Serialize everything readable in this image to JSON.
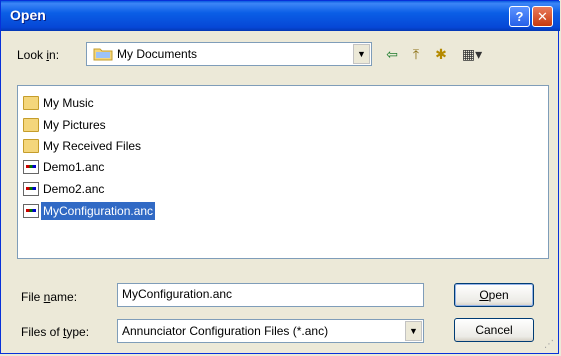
{
  "window": {
    "title": "Open",
    "help_glyph": "?",
    "close_glyph": "✕"
  },
  "lookin": {
    "label_pre": "Look ",
    "label_accel": "i",
    "label_post": "n:",
    "value": "My Documents",
    "icon": "folder-icon"
  },
  "toolbar": {
    "back_icon": "⇦",
    "up_icon": "⤒",
    "new_folder_icon": "✱",
    "views_icon": "▦▾"
  },
  "files": [
    {
      "name": "My Music",
      "kind": "folder"
    },
    {
      "name": "My Pictures",
      "kind": "folder"
    },
    {
      "name": "My Received Files",
      "kind": "folder"
    },
    {
      "name": "Demo1.anc",
      "kind": "file"
    },
    {
      "name": "Demo2.anc",
      "kind": "file"
    },
    {
      "name": "MyConfiguration.anc",
      "kind": "file",
      "selected": true
    }
  ],
  "filename": {
    "label_pre": "File ",
    "label_accel": "n",
    "label_post": "ame:",
    "value": "MyConfiguration.anc"
  },
  "filetype": {
    "label_pre": "Files of ",
    "label_accel": "t",
    "label_post": "ype:",
    "value": "Annunciator Configuration Files (*.anc)"
  },
  "buttons": {
    "open_accel": "O",
    "open_rest": "pen",
    "cancel": "Cancel"
  },
  "colors": {
    "titlebar": "#0a5ee6",
    "selection": "#316ac5",
    "close": "#c7390f"
  }
}
